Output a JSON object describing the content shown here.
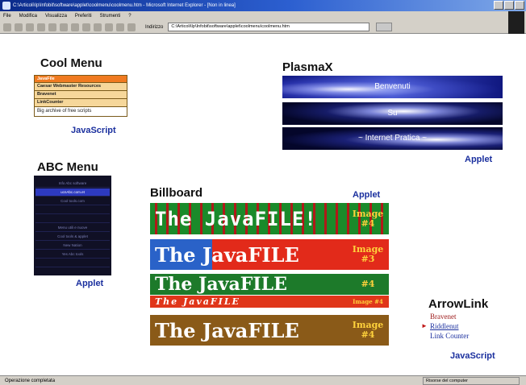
{
  "window": {
    "title": "C:\\Articoli\\Ip\\Infobit\\software\\applet\\coolmenu\\coolmenu.htm - Microsoft Internet Explorer - [Non in linea]",
    "menu": [
      "File",
      "Modifica",
      "Visualizza",
      "Preferiti",
      "Strumenti",
      "?"
    ],
    "address_label": "Indirizzo",
    "address": "C:\\Articoli\\Ip\\Infobit\\software\\applet\\coolmenu\\coolmenu.htm",
    "status_left": "Operazione completata",
    "status_right": "Risorse del computer"
  },
  "cool_menu": {
    "heading": "Cool Menu",
    "items": [
      "JavaFile",
      "Caesar Webmaster Resources",
      "Bravenet",
      "LinkCounter",
      "Big archive of free scripts"
    ],
    "tag": "JavaScript"
  },
  "plasmax": {
    "heading": "PlasmaX",
    "buttons": [
      "Benvenuti",
      "Su",
      "~ Internet Pratica ~"
    ],
    "tag": "Applet"
  },
  "abc_menu": {
    "heading": "ABC Menu",
    "items": [
      "Info Abc software",
      "ucnAbc.com.et",
      "Cool tools.com",
      "",
      "",
      "Menu utili e nuove",
      "Cool tools & applet",
      "New Nation",
      "Yes Abc tools",
      "",
      "",
      ""
    ],
    "tag": "Applet"
  },
  "billboard": {
    "heading": "Billboard",
    "tag": "Applet",
    "banners": [
      {
        "text": "The JavaFILE!",
        "image": "Image #4"
      },
      {
        "text": "The JavaFILE",
        "image": "Image #3"
      },
      {
        "text": "The JavaFILE",
        "image": "#4"
      },
      {
        "text": "The JavaFILE",
        "image": "Image #4"
      },
      {
        "text": "The JavaFILE",
        "image": "Image #4"
      }
    ]
  },
  "arrowlink": {
    "heading": "ArrowLink",
    "links": [
      "Bravenet",
      "Riddlenut",
      "Link Counter"
    ],
    "tag": "JavaScript",
    "arrow_glyph": "►"
  }
}
